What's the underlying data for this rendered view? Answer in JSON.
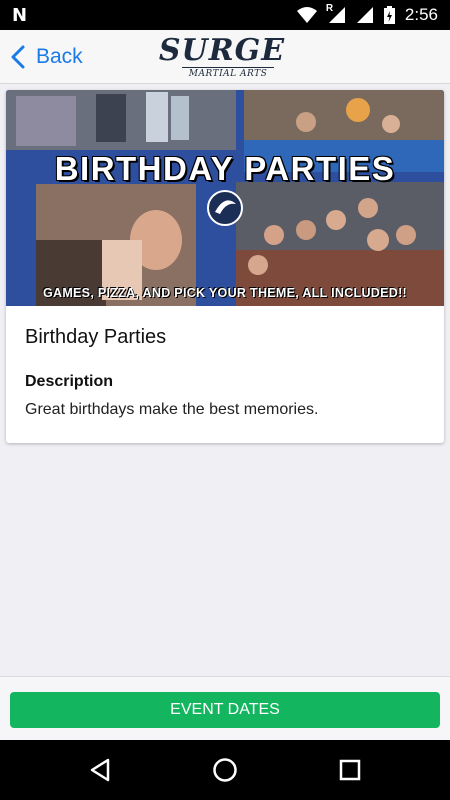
{
  "status_bar": {
    "time": "2:56",
    "left_icon": "notification-n-icon",
    "roaming_label": "R",
    "icons": [
      "wifi-icon",
      "signal-icon",
      "signal-icon",
      "battery-icon"
    ]
  },
  "nav": {
    "back_label": "Back",
    "logo_text": "SURGE",
    "logo_subtext": "MARTIAL ARTS"
  },
  "event": {
    "banner_title": "BIRTHDAY PARTIES",
    "banner_caption": "GAMES, PIZZA, AND PICK YOUR THEME, ALL INCLUDED!!",
    "title": "Birthday Parties",
    "description_label": "Description",
    "description": "Great birthdays make the best memories."
  },
  "actions": {
    "event_dates_label": "EVENT DATES"
  },
  "android_nav": {
    "back": "back-triangle-icon",
    "home": "home-circle-icon",
    "recents": "recents-square-icon"
  },
  "colors": {
    "accent": "#1a7ae8",
    "button_green": "#13b65f",
    "banner_blue": "#2e54a8"
  }
}
